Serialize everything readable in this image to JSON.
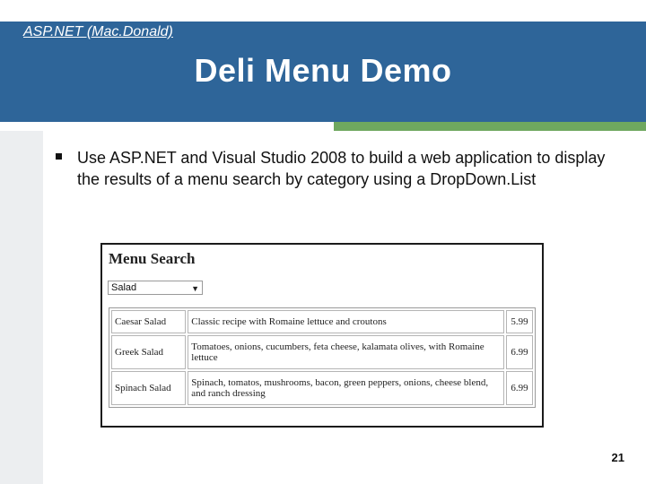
{
  "header": {
    "course_title": "ASP.NET (Mac.Donald)",
    "slide_title": "Deli Menu Demo"
  },
  "bullet": {
    "text": "Use ASP.NET and Visual Studio 2008 to build a web application to display the results of a menu search by category using a DropDown.List"
  },
  "app": {
    "heading": "Menu Search",
    "category_select": {
      "selected": "Salad"
    },
    "table": {
      "rows": [
        {
          "name": "Caesar Salad",
          "description": "Classic recipe with Romaine lettuce and croutons",
          "price": "5.99"
        },
        {
          "name": "Greek Salad",
          "description": "Tomatoes, onions, cucumbers, feta cheese, kalamata olives, with Romaine lettuce",
          "price": "6.99"
        },
        {
          "name": "Spinach Salad",
          "description": "Spinach, tomatos, mushrooms, bacon, green peppers, onions, cheese blend, and ranch dressing",
          "price": "6.99"
        }
      ]
    }
  },
  "footer": {
    "page_number": "21"
  },
  "colors": {
    "header": "#2e6599",
    "accent_green": "#6fa85f",
    "left_margin": "#eceef0"
  },
  "icons": {
    "bullet": "square-bullet-icon",
    "dropdown": "chevron-down-icon"
  }
}
